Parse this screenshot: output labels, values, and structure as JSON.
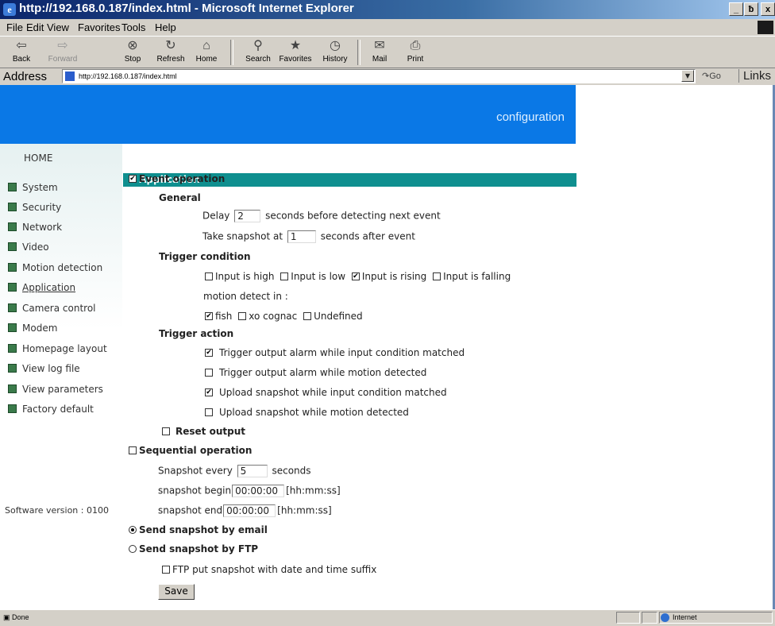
{
  "window": {
    "title": "http://192.168.0.187/index.html - Microsoft Internet Explorer",
    "minimize": "_",
    "maximize": "ƀ",
    "close": "x"
  },
  "menu": [
    "File",
    "Edit",
    "View",
    "Favorites",
    "Tools",
    "Help"
  ],
  "toolbar": {
    "back": "Back",
    "forward": "Forward",
    "stop": "Stop",
    "refresh": "Refresh",
    "home": "Home",
    "search": "Search",
    "favorites": "Favorites",
    "history": "History",
    "mail": "Mail",
    "print": "Print"
  },
  "address": {
    "label": "Address",
    "url": "http://192.168.0.187/index.html",
    "go": "Go",
    "links": "Links"
  },
  "header": {
    "text": "configuration"
  },
  "sidebar": {
    "home": "HOME",
    "items": [
      "System",
      "Security",
      "Network",
      "Video",
      "Motion detection",
      "Application",
      "Camera control",
      "Modem",
      "Homepage layout",
      "View log file",
      "View parameters",
      "Factory default"
    ],
    "active_index": 5,
    "software_version": "Software version : 0100"
  },
  "section": {
    "title": "> Application"
  },
  "form": {
    "event_operation": {
      "label": "Event operation",
      "checked": true
    },
    "general": {
      "heading": "General",
      "delay_prefix": "Delay",
      "delay_value": "2",
      "delay_suffix": "seconds before detecting next event",
      "snapshot_prefix": "Take snapshot at",
      "snapshot_value": "1",
      "snapshot_suffix": "seconds after event"
    },
    "trigger_condition": {
      "heading": "Trigger condition",
      "inputs": [
        {
          "label": "Input is high",
          "checked": false
        },
        {
          "label": "Input is low",
          "checked": false
        },
        {
          "label": "Input is rising",
          "checked": true
        },
        {
          "label": "Input is falling",
          "checked": false
        }
      ],
      "motion_label": "motion detect in :",
      "motion_windows": [
        {
          "label": "fish",
          "checked": true
        },
        {
          "label": "xo cognac",
          "checked": false
        },
        {
          "label": "Undefined",
          "checked": false
        }
      ]
    },
    "trigger_action": {
      "heading": "Trigger action",
      "actions": [
        {
          "label": "Trigger output alarm while input condition matched",
          "checked": true
        },
        {
          "label": "Trigger output alarm while motion detected",
          "checked": false
        },
        {
          "label": "Upload snapshot while input condition matched",
          "checked": true
        },
        {
          "label": "Upload snapshot while motion detected",
          "checked": false
        }
      ]
    },
    "reset_output": {
      "label": "Reset output",
      "checked": false
    },
    "sequential": {
      "label": "Sequential operation",
      "checked": false,
      "every_prefix": "Snapshot every",
      "every_value": "5",
      "every_suffix": "seconds",
      "begin_prefix": "snapshot begin",
      "begin_value": "00:00:00",
      "begin_suffix": "[hh:mm:ss]",
      "end_prefix": "snapshot end",
      "end_value": "00:00:00",
      "end_suffix": "[hh:mm:ss]"
    },
    "send_email": {
      "label": "Send snapshot by email",
      "selected": true
    },
    "send_ftp": {
      "label": "Send snapshot by FTP",
      "selected": false
    },
    "ftp_suffix": {
      "label": "FTP put snapshot with date and time suffix",
      "checked": false
    },
    "save": "Save"
  },
  "status": {
    "text": "Done",
    "zone": "Internet"
  }
}
